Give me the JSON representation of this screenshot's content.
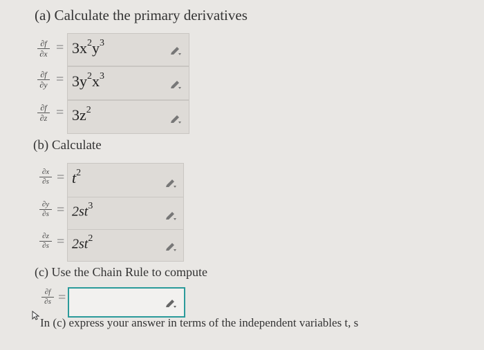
{
  "part_a": {
    "heading": "(a) Calculate the primary derivatives",
    "rows": [
      {
        "num": "∂f",
        "den": "∂x",
        "eq": "=",
        "base1": "3x",
        "exp1": "2",
        "base2": "y",
        "exp2": "3"
      },
      {
        "num": "∂f",
        "den": "∂y",
        "eq": "=",
        "base1": "3y",
        "exp1": "2",
        "base2": "x",
        "exp2": "3"
      },
      {
        "num": "∂f",
        "den": "∂z",
        "eq": "=",
        "base1": "3z",
        "exp1": "2",
        "base2": "",
        "exp2": ""
      }
    ]
  },
  "part_b": {
    "heading": "(b) Calculate",
    "rows": [
      {
        "num": "∂x",
        "den": "∂s",
        "eq": "=",
        "base1": "t",
        "exp1": "2",
        "base2": "",
        "exp2": ""
      },
      {
        "num": "∂y",
        "den": "∂s",
        "eq": "=",
        "base1": "2st",
        "exp1": "3",
        "base2": "",
        "exp2": ""
      },
      {
        "num": "∂z",
        "den": "∂s",
        "eq": "=",
        "base1": "2st",
        "exp1": "2",
        "base2": "",
        "exp2": ""
      }
    ]
  },
  "part_c": {
    "heading": "(c) Use the Chain Rule to compute",
    "num": "∂f",
    "den": "∂s",
    "eq": "=",
    "answer_value": "",
    "note": "In (c) express your answer in terms of the independent variables t, s"
  },
  "icons": {
    "edit": "pencil-icon",
    "cursor": "mouse-pointer-icon"
  },
  "colors": {
    "answer_border": "#2a9a9a",
    "filled_box": "#dedbd7"
  }
}
